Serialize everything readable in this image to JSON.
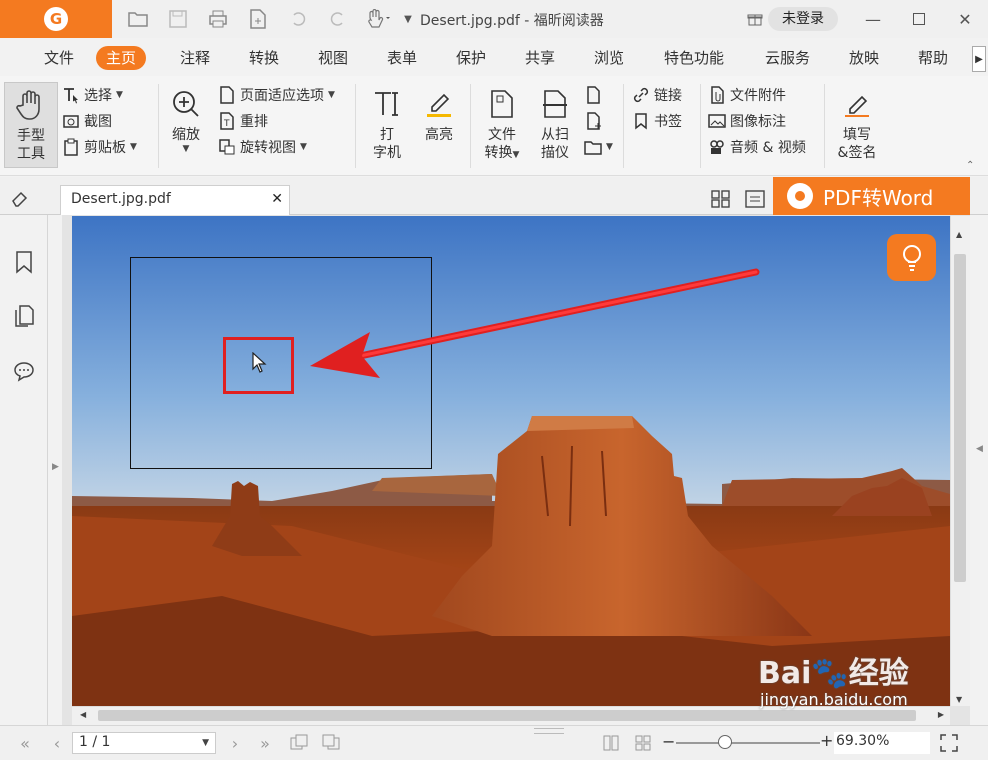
{
  "window": {
    "title": "Desert.jpg.pdf - 福昕阅读器",
    "login_label": "未登录"
  },
  "menu": {
    "tabs": [
      "文件",
      "主页",
      "注释",
      "转换",
      "视图",
      "表单",
      "保护",
      "共享",
      "浏览",
      "特色功能",
      "云服务",
      "放映",
      "帮助"
    ],
    "active": "主页"
  },
  "ribbon": {
    "hand_tool": [
      "手型",
      "工具"
    ],
    "select": "选择",
    "screenshot": "截图",
    "clipboard": "剪贴板",
    "zoom": "缩放",
    "page_fit": "页面适应选项",
    "reflow": "重排",
    "rotate": "旋转视图",
    "typewriter": [
      "打",
      "字机"
    ],
    "highlight": "高亮",
    "file_convert": [
      "文件",
      "转换"
    ],
    "scan": [
      "从扫",
      "描仪"
    ],
    "link": "链接",
    "bookmark": "书签",
    "file_attachment": "文件附件",
    "image_annotation": "图像标注",
    "audio_video": "音频 & 视频",
    "fill_sign": [
      "填写",
      "&签名"
    ]
  },
  "document": {
    "tab_name": "Desert.jpg.pdf",
    "promo": "PDF转Word"
  },
  "statusbar": {
    "page": "1 / 1",
    "zoom": "69.30%",
    "zoom_level_fraction": 0.3
  },
  "watermark": {
    "brand": "Bai",
    "suffix": "经验",
    "url": "jingyan.baidu.com"
  },
  "colors": {
    "accent": "#f47a20",
    "annotation_red": "#e02020"
  }
}
